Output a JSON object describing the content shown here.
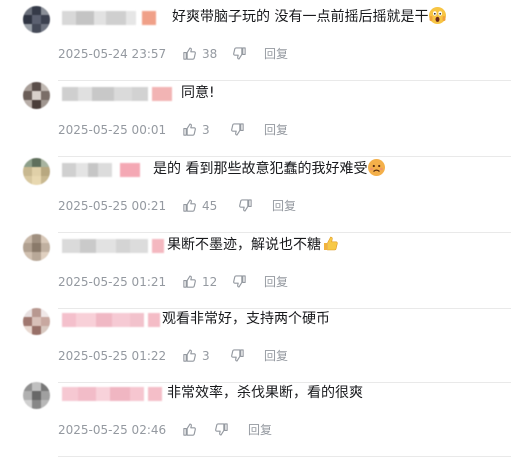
{
  "comments": [
    {
      "text": "好爽带脑子玩的 没有一点前摇后摇就是干",
      "emoji": "scream-emoji",
      "time": "2025-05-24 23:57",
      "likes": "38",
      "reply_label": "回复"
    },
    {
      "text": "同意!",
      "emoji": "",
      "time": "2025-05-25 00:01",
      "likes": "3",
      "reply_label": "回复"
    },
    {
      "text": "是的 看到那些故意犯蠢的我好难受",
      "emoji": "sad-emoji",
      "time": "2025-05-25 00:21",
      "likes": "45",
      "reply_label": "回复"
    },
    {
      "text": "果断不墨迹，解说也不糖",
      "emoji": "thumbs-up-emoji",
      "time": "2025-05-25 01:21",
      "likes": "12",
      "reply_label": "回复"
    },
    {
      "text": "观看非常好，支持两个硬币",
      "emoji": "",
      "time": "2025-05-25 01:22",
      "likes": "3",
      "reply_label": "回复"
    },
    {
      "text": "非常效率，杀伐果断，看的很爽",
      "emoji": "",
      "time": "2025-05-25 02:46",
      "likes": "",
      "reply_label": "回复"
    }
  ],
  "colors": {
    "text": "#18191c",
    "meta": "#9499a0",
    "divider": "#e9e9e9",
    "vip_pink": "#f5a0b4"
  }
}
